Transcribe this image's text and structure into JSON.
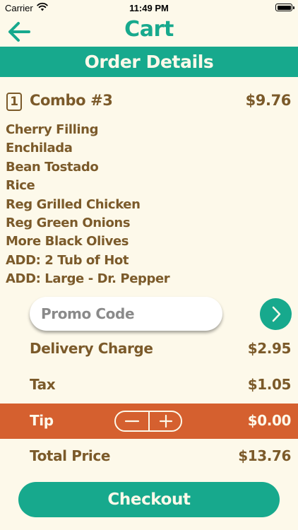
{
  "status_bar": {
    "carrier": "Carrier",
    "time": "11:49 PM"
  },
  "header": {
    "title": "Cart",
    "back_icon": "arrow-left-icon"
  },
  "banner": {
    "title": "Order Details"
  },
  "combo": {
    "quantity": "1",
    "name": "Combo #3",
    "price": "$9.76",
    "items": [
      "Cherry Filling",
      "Enchilada",
      "Bean Tostado",
      "Rice",
      "Reg Grilled Chicken",
      "Reg Green Onions",
      "More Black Olives",
      "ADD: 2 Tub of Hot",
      "ADD: Large - Dr. Pepper"
    ]
  },
  "promo": {
    "placeholder": "Promo Code",
    "value": "",
    "submit_icon": "chevron-right-icon"
  },
  "summary": {
    "delivery_label": "Delivery Charge",
    "delivery_value": "$2.95",
    "tax_label": "Tax",
    "tax_value": "$1.05",
    "tip_label": "Tip",
    "tip_value": "$0.00",
    "total_label": "Total Price",
    "total_value": "$13.76"
  },
  "checkout": {
    "label": "Checkout"
  },
  "colors": {
    "teal": "#17a98d",
    "brown": "#7b5a2a",
    "orange": "#d5602f",
    "cream": "#fdf9ea"
  }
}
